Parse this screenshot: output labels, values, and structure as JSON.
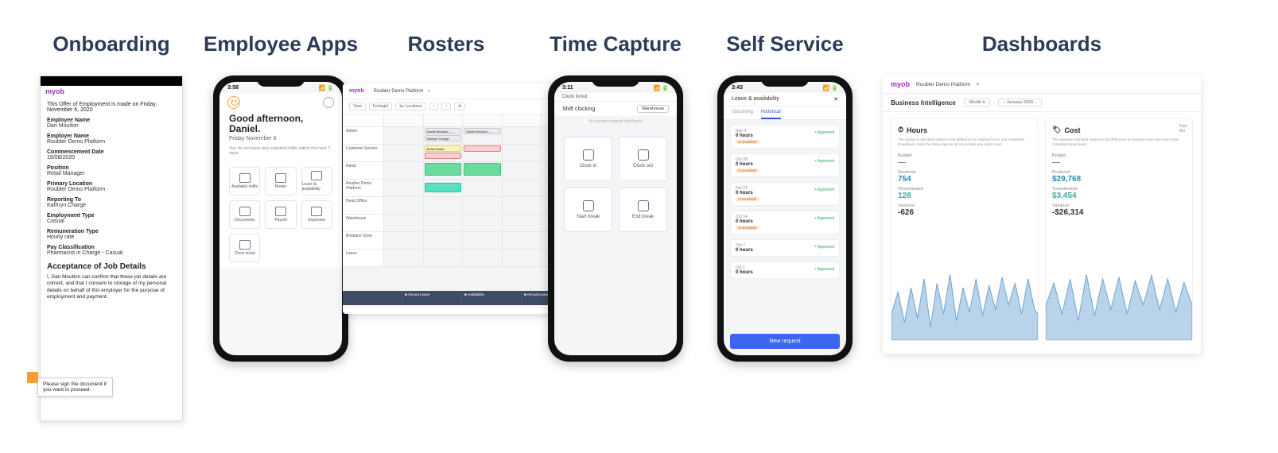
{
  "columns": {
    "onboarding": "Onboarding",
    "apps": "Employee Apps",
    "rosters": "Rosters",
    "time": "Time Capture",
    "self": "Self Service",
    "dash": "Dashboards"
  },
  "brand": "myob",
  "onboard": {
    "intro": "This Offer of Employment is made on Friday, November 6, 2020",
    "fields": [
      {
        "lab": "Employee Name",
        "val": "Dan Moulton"
      },
      {
        "lab": "Employer Name",
        "val": "Roubler Demo Platform"
      },
      {
        "lab": "Commencement Date",
        "val": "19/08/2020"
      },
      {
        "lab": "Position",
        "val": "Retail Manager"
      },
      {
        "lab": "Primary Location",
        "val": "Roubler Demo Platform"
      },
      {
        "lab": "Reporting To",
        "val": "Kathryn Charge"
      },
      {
        "lab": "Employment Type",
        "val": "Casual"
      },
      {
        "lab": "Remuneration Type",
        "val": "Hourly rate"
      },
      {
        "lab": "Pay Classification",
        "val": "Pharmacist in Charge - Casual"
      }
    ],
    "accept_heading": "Acceptance of Job Details",
    "accept_text": "I, Dan Moulton can confirm that these job details are correct, and that I consent to storage of my personal details on behalf of this employer for the purpose of employment and payment.",
    "sign_note": "Please sign the document if you want to proceed."
  },
  "apps": {
    "time": "3:58",
    "greeting1": "Good afternoon,",
    "greeting2": "Daniel.",
    "date": "Friday November 6",
    "note": "You do not have any rostered shifts within the next 7 days",
    "tiles": [
      "Available shifts",
      "Roster",
      "Leave & availability",
      "Documents",
      "Payroll",
      "Expenses",
      "Clock in/out"
    ]
  },
  "rosters": {
    "platform": "Roubler Demo Platform",
    "view": "View",
    "fortnight": "Fortnight",
    "locations_btn": "by Locations",
    "sidebar": [
      "Admin",
      "Customer Service",
      "Retail",
      "Roubler Demo Platform",
      "Head Office",
      "Warehouse",
      "Brisbane Store",
      "Leave"
    ],
    "footer": [
      "Annual Leave",
      "Availability",
      "Annual Leave"
    ],
    "shift_labels": {
      "manager": "Daniel Moulton — Store Manager",
      "charge": "Kathryn Charge",
      "retail": "Retail Assist"
    }
  },
  "time": {
    "clock_in_out": "Clock in/out",
    "time": "3:11",
    "title": "Shift clocking",
    "loc": "Warehouse",
    "note": "No current rostered shift found",
    "tiles": [
      "Clock in",
      "Clock out",
      "Start break",
      "End break"
    ]
  },
  "self": {
    "time": "3:43",
    "title": "Leave & availability",
    "tabs": [
      "Upcoming",
      "Historical"
    ],
    "items": [
      {
        "date": "Nov 4",
        "hours": "0 hours",
        "status": "• Approved",
        "badge": "Unavailable"
      },
      {
        "date": "Oct 28",
        "hours": "0 hours",
        "status": "• Approved",
        "badge": "Unavailable"
      },
      {
        "date": "Oct 21",
        "hours": "0 hours",
        "status": "• Approved",
        "badge": "Unavailable"
      },
      {
        "date": "Oct 14",
        "hours": "0 hours",
        "status": "• Approved",
        "badge": "Unavailable"
      },
      {
        "date": "Oct 7",
        "hours": "0 hours",
        "status": "• Approved",
        "badge": ""
      },
      {
        "date": "Oct 1",
        "hours": "0 hours",
        "status": "• Approved",
        "badge": ""
      }
    ],
    "button": "New request"
  },
  "dash": {
    "platform": "Roubler Demo Platform",
    "bi": "Business Intelligence",
    "period": "Month",
    "period_val": "January 2020",
    "hours": {
      "title": "Hours",
      "icon": "⏱",
      "desc": "The variance indicated relates to the difference in rostered hours and completed timesheets. Note the below figures do not include any open hours.",
      "budget_lab": "Budget",
      "budget_val": "—",
      "rostered_lab": "Rostered",
      "rostered_val": "754",
      "ts_lab": "Timesheeted",
      "ts_val": "128",
      "var_lab": "Variance",
      "var_val": "-626"
    },
    "cost": {
      "title": "Cost",
      "icon": "🏷",
      "desc": "The variance indicated relates to the difference in rostered costs and cost of the completed timesheets.",
      "budget_lab": "Budget",
      "budget_val": "—",
      "rostered_lab": "Rostered",
      "rostered_val": "$29,768",
      "ts_lab": "Timesheeted",
      "ts_val": "$3,454",
      "var_lab": "Variance",
      "var_val": "-$26,314",
      "fore_lab": "Fore",
      "act_lab": "Act"
    }
  }
}
